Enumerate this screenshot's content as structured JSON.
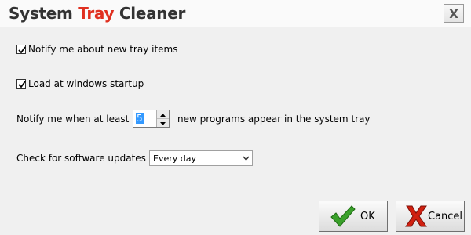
{
  "window": {
    "title_part1": "System",
    "title_part2": "Tray",
    "title_part3": "Cleaner",
    "close_label": "X"
  },
  "options": {
    "notify_new_items": {
      "label": "Notify me about new tray items",
      "checked": true
    },
    "load_at_startup": {
      "label": "Load at windows startup",
      "checked": true
    }
  },
  "threshold": {
    "label_before": "Notify me when at least",
    "value": "5",
    "label_after": "new programs appear in the system tray"
  },
  "updates": {
    "label": "Check for software updates",
    "selected": "Every day"
  },
  "buttons": {
    "ok_label": "OK",
    "cancel_label": "Cancel"
  },
  "colors": {
    "title_accent": "#e03020",
    "ok_icon": "#3aa02a",
    "cancel_icon": "#d02010"
  }
}
